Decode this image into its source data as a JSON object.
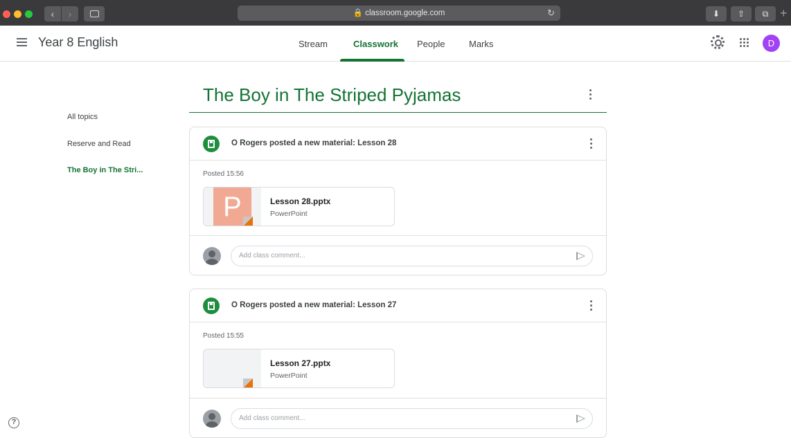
{
  "browser": {
    "url": "🔒 classroom.google.com",
    "reload_glyph": "↻",
    "back_glyph": "‹",
    "forward_glyph": "›",
    "download_glyph": "⬇",
    "share_glyph": "⇧",
    "tabs_glyph": "⧉",
    "new_tab_glyph": "+"
  },
  "header": {
    "class_title": "Year 8 English",
    "tabs": [
      {
        "label": "Stream"
      },
      {
        "label": "Classwork"
      },
      {
        "label": "People"
      },
      {
        "label": "Marks"
      }
    ],
    "active_tab": "Classwork",
    "avatar_letter": "D",
    "accent_color": "#137333",
    "avatar_color": "#a142f4"
  },
  "sidebar": {
    "topics": [
      {
        "label": "All topics"
      },
      {
        "label": "Reserve and Read"
      },
      {
        "label": "The Boy in The Stri..."
      }
    ],
    "help_glyph": "?"
  },
  "main": {
    "topic_heading": "The Boy in The Striped Pyjamas",
    "posts": [
      {
        "title": "O Rogers posted a new material: Lesson 28",
        "posted": "Posted 15:56",
        "attachment_name": "Lesson 28.pptx",
        "attachment_type": "PowerPoint",
        "thumbnail_letter": "P",
        "comment_placeholder": "Add class comment..."
      },
      {
        "title": "O Rogers posted a new material: Lesson 27",
        "posted": "Posted 15:55",
        "attachment_name": "Lesson 27.pptx",
        "attachment_type": "PowerPoint",
        "comment_placeholder": "Add class comment..."
      }
    ]
  }
}
